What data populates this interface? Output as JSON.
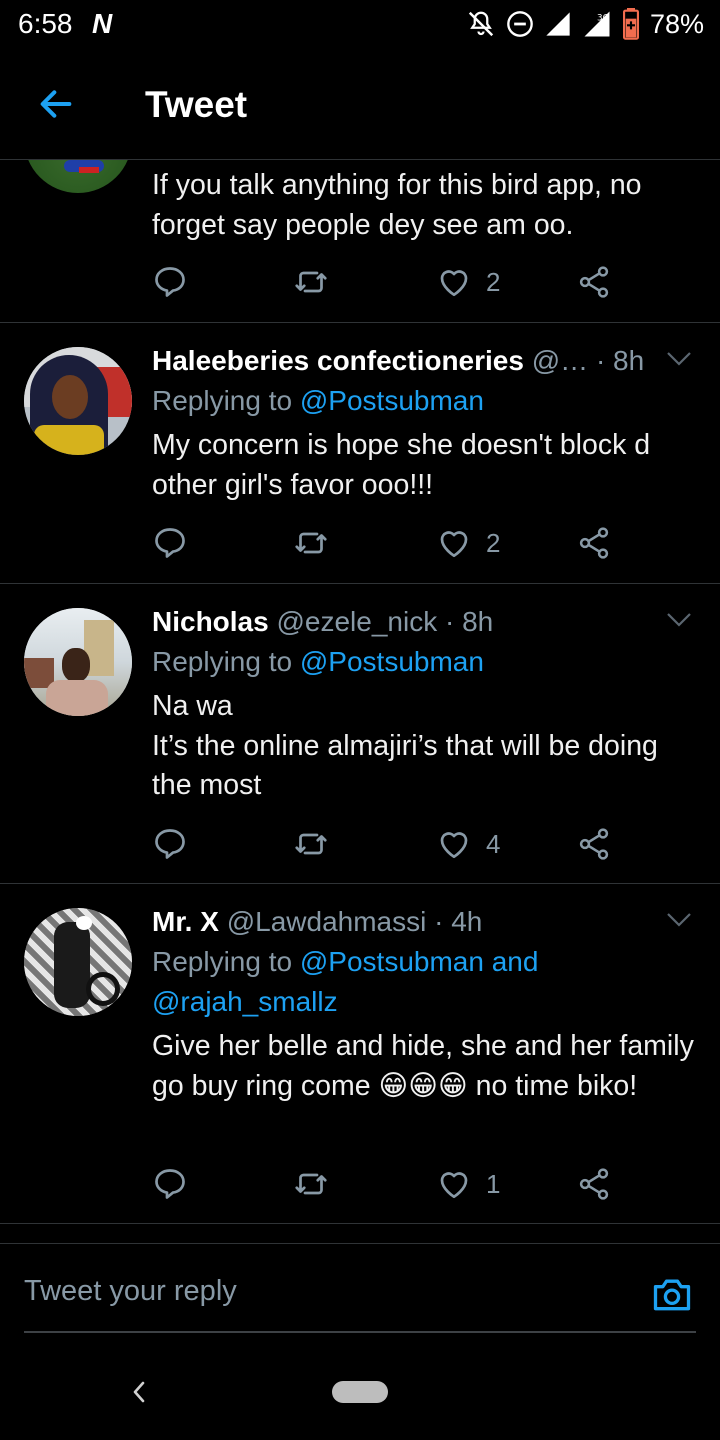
{
  "status_bar": {
    "time": "6:58",
    "app_icon": "N",
    "network": "3G",
    "battery": "78%"
  },
  "header": {
    "title": "Tweet"
  },
  "tweets": [
    {
      "text": "If you talk anything for this bird app, no forget say people dey see am oo.",
      "likes": "2"
    },
    {
      "name": "Haleeberies confectioneries",
      "handle": "@…",
      "time": "· 8h",
      "replying_prefix": "Replying to ",
      "replying_to": "@Postsubman",
      "text": "My concern is hope she doesn't block d other girl's favor ooo!!!",
      "likes": "2"
    },
    {
      "name": "Nicholas",
      "handle": "@ezele_nick",
      "time": "· 8h",
      "replying_prefix": "Replying to ",
      "replying_to": "@Postsubman",
      "text_line1": "Na wa",
      "text_line2": "It’s the online almajiri’s that will be doing the most",
      "likes": "4"
    },
    {
      "name": "Mr. X",
      "handle": "@Lawdahmassi",
      "time": "· 4h",
      "replying_prefix": "Replying to ",
      "replying_to": "@Postsubman and @rajah_smallz",
      "text_a": "Give her belle and hide, she and her family go buy ring come ",
      "emojis": "😁😁😁",
      "text_b": " no time biko!",
      "likes": "1"
    }
  ],
  "reply_bar": {
    "placeholder": "Tweet your reply"
  },
  "colors": {
    "accent": "#1da1f2",
    "muted": "#8899a6",
    "background": "#000000"
  }
}
